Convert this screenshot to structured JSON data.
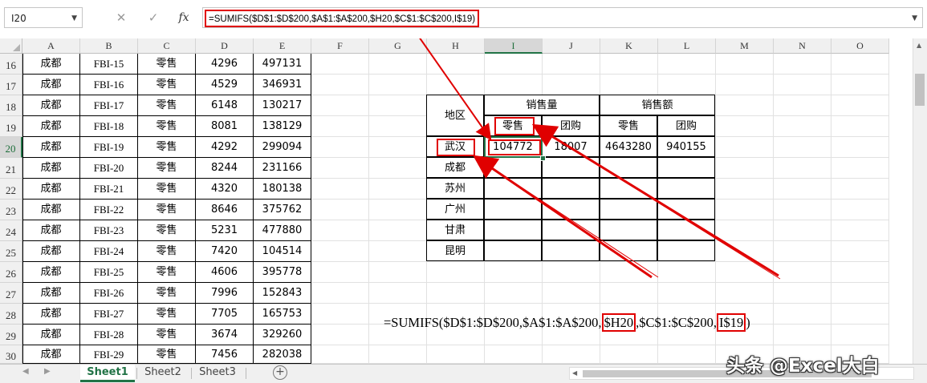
{
  "formula_bar": {
    "name_box": "I20",
    "cancel_icon": "✕",
    "enter_icon": "✓",
    "fx_label": "fx",
    "formula": "=SUMIFS($D$1:$D$200,$A$1:$A$200,$H20,$C$1:$C$200,I$19)"
  },
  "columns": [
    "A",
    "B",
    "C",
    "D",
    "E",
    "F",
    "G",
    "H",
    "I",
    "J",
    "K",
    "L",
    "M",
    "N",
    "O"
  ],
  "rows": [
    "16",
    "17",
    "18",
    "19",
    "20",
    "21",
    "22",
    "23",
    "24",
    "25",
    "26",
    "27",
    "28",
    "29",
    "30"
  ],
  "data_rows": [
    [
      "成都",
      "FBI-15",
      "零售",
      "4296",
      "497131"
    ],
    [
      "成都",
      "FBI-16",
      "零售",
      "4529",
      "346931"
    ],
    [
      "成都",
      "FBI-17",
      "零售",
      "6148",
      "130217"
    ],
    [
      "成都",
      "FBI-18",
      "零售",
      "8081",
      "138129"
    ],
    [
      "成都",
      "FBI-19",
      "零售",
      "4292",
      "299094"
    ],
    [
      "成都",
      "FBI-20",
      "零售",
      "8244",
      "231166"
    ],
    [
      "成都",
      "FBI-21",
      "零售",
      "4320",
      "180138"
    ],
    [
      "成都",
      "FBI-22",
      "零售",
      "8646",
      "375762"
    ],
    [
      "成都",
      "FBI-23",
      "零售",
      "5231",
      "477880"
    ],
    [
      "成都",
      "FBI-24",
      "零售",
      "7420",
      "104514"
    ],
    [
      "成都",
      "FBI-25",
      "零售",
      "4606",
      "395778"
    ],
    [
      "成都",
      "FBI-26",
      "零售",
      "7996",
      "152843"
    ],
    [
      "成都",
      "FBI-27",
      "零售",
      "7705",
      "165753"
    ],
    [
      "成都",
      "FBI-28",
      "零售",
      "3674",
      "329260"
    ],
    [
      "成都",
      "FBI-29",
      "零售",
      "7456",
      "282038"
    ]
  ],
  "summary": {
    "region_header": "地区",
    "qty_header": "销售量",
    "amt_header": "销售额",
    "sub_headers": [
      "零售",
      "团购",
      "零售",
      "团购"
    ],
    "regions": [
      "武汉",
      "成都",
      "苏州",
      "广州",
      "甘肃",
      "昆明"
    ],
    "wuhan_values": [
      "104772",
      "18007",
      "4643280",
      "940155"
    ]
  },
  "formula_display": {
    "part1": "=SUMIFS($D$1:$D$200,$A$1:$A$200,",
    "box1": "$H20",
    "part2": ",$C$1:$C$200,",
    "box2": "I$19",
    "part3": ")"
  },
  "sheets": [
    "Sheet1",
    "Sheet2",
    "Sheet3"
  ],
  "active_sheet": "Sheet1",
  "watermark": "头条 @Excel大白",
  "colors": {
    "accent": "#217346",
    "highlight": "#e00000"
  }
}
